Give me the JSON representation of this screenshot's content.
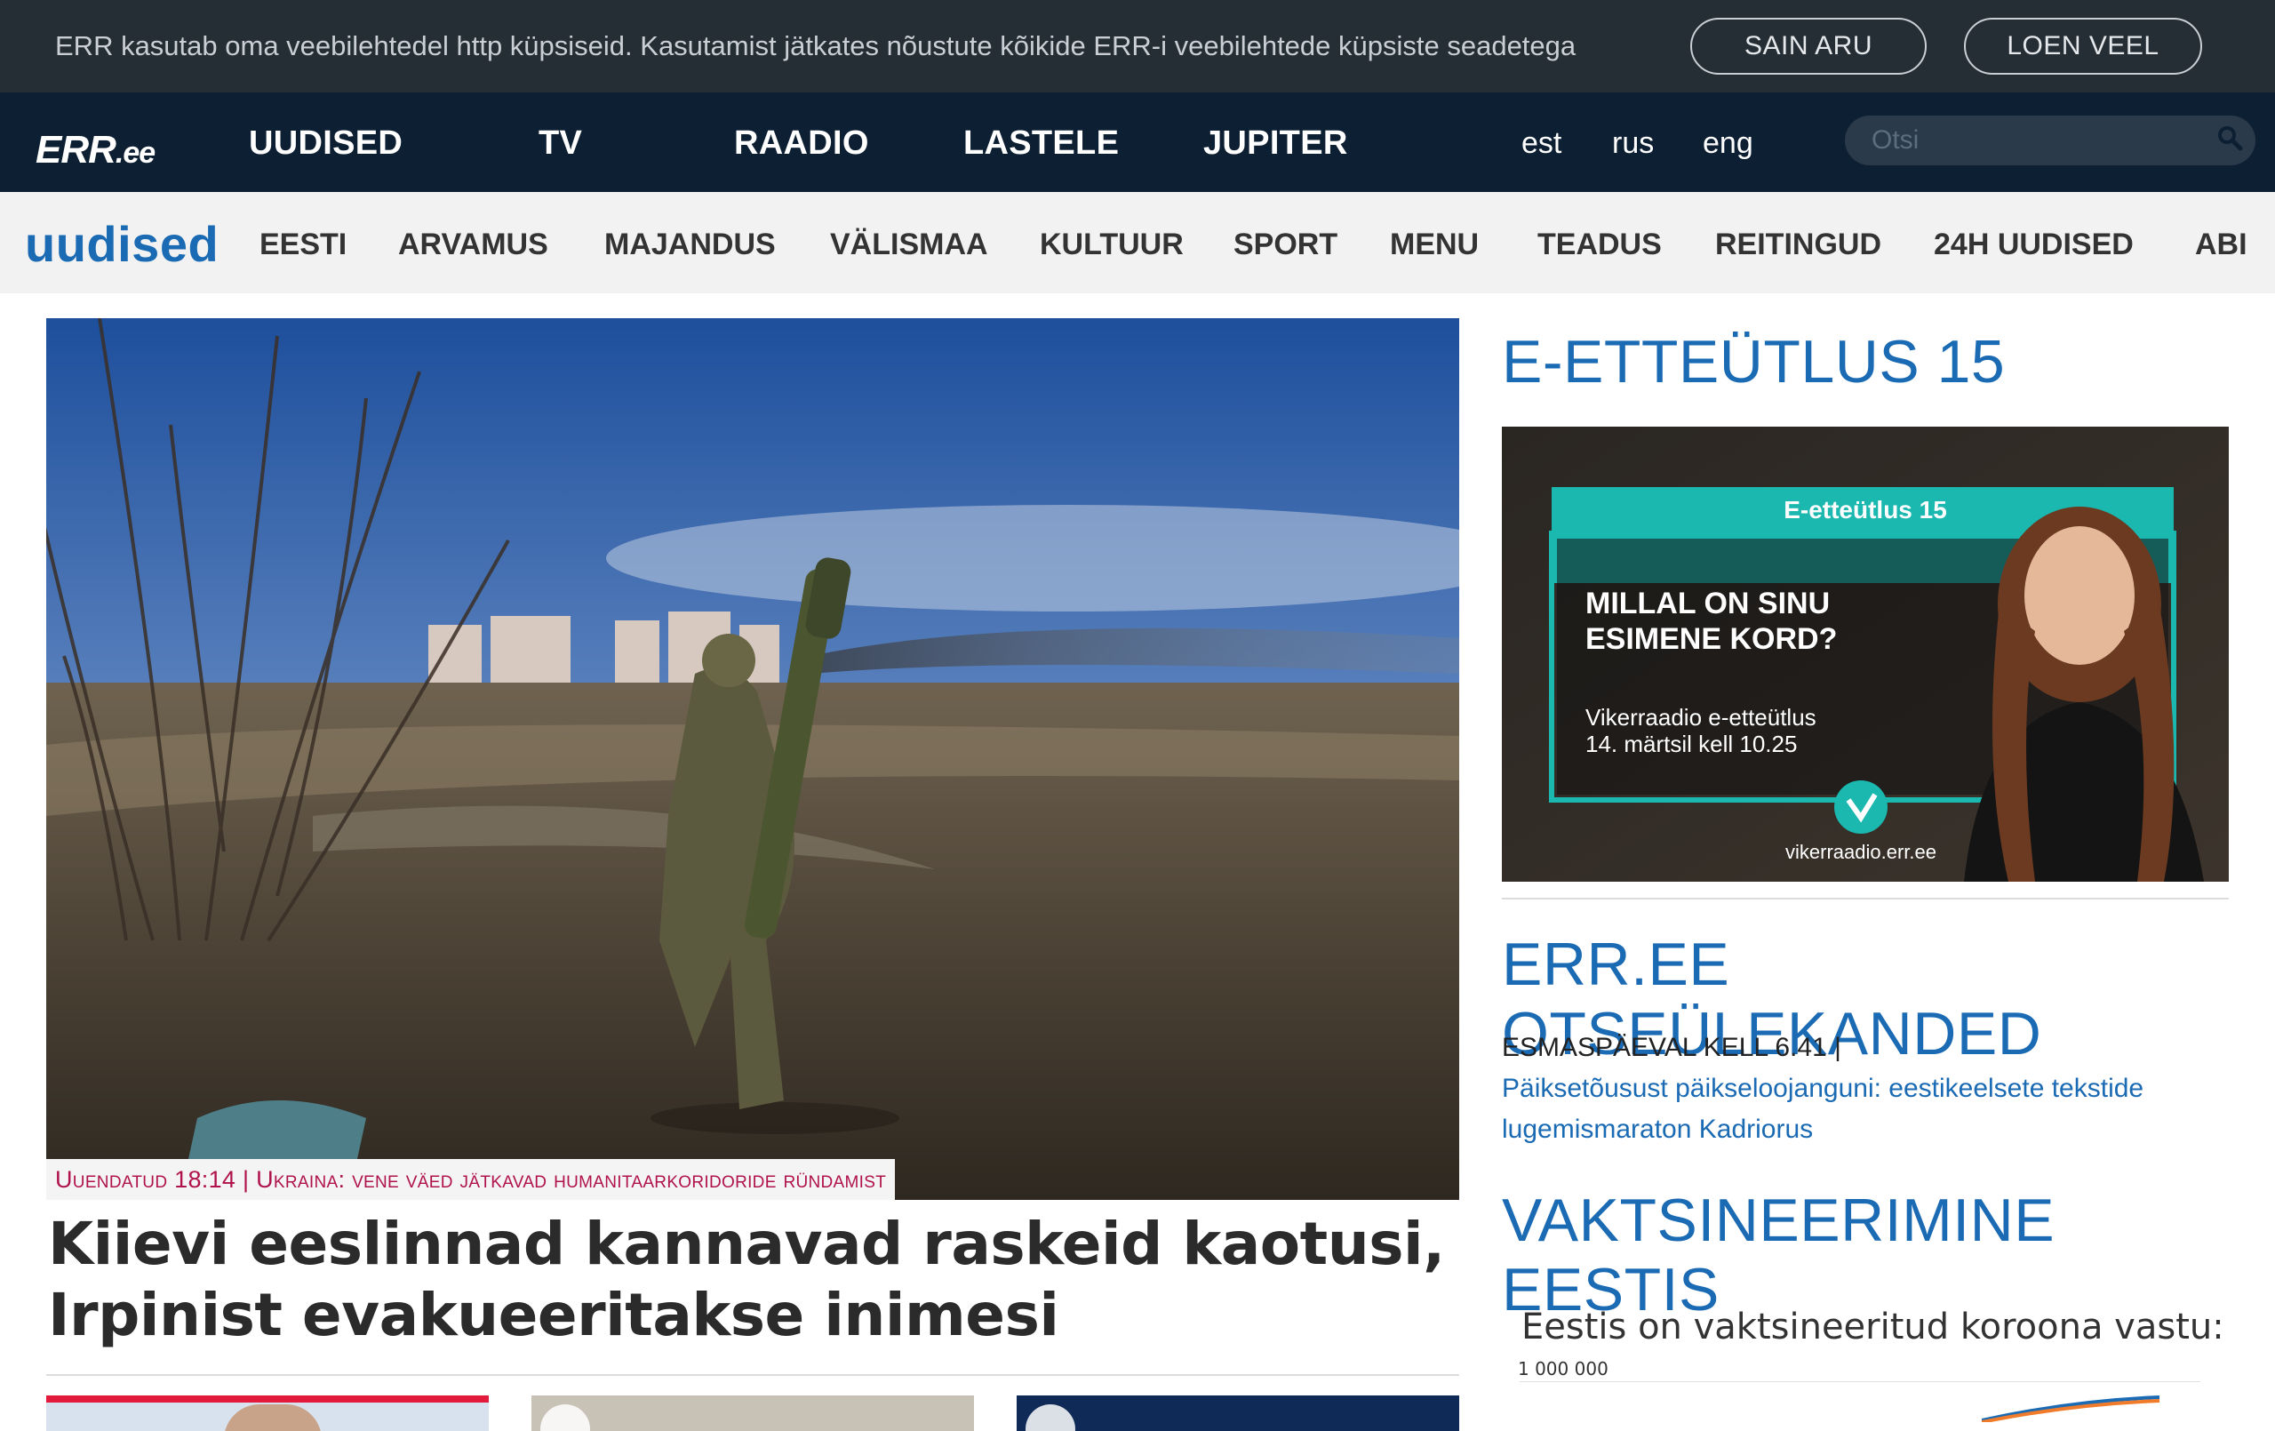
{
  "cookie": {
    "text": "ERR kasutab oma veebilehtedel http küpsiseid. Kasutamist jätkates nõustute kõikide ERR-i veebilehtede küpsiste seadetega",
    "accept_label": "SAIN ARU",
    "more_label": "LOEN VEEL"
  },
  "nav": {
    "logo": "ERR",
    "logo_suffix": ".ee",
    "items": [
      "UUDISED",
      "TV",
      "RAADIO",
      "LASTELE",
      "JUPITER"
    ],
    "languages": [
      "est",
      "rus",
      "eng"
    ],
    "search_placeholder": "Otsi"
  },
  "subnav": {
    "section_title": "uudised",
    "items": [
      "EESTI",
      "ARVAMUS",
      "MAJANDUS",
      "VÄLISMAA",
      "KULTUUR",
      "SPORT",
      "MENU",
      "TEADUS",
      "REITINGUD",
      "24H UUDISED",
      "ABI"
    ]
  },
  "hero": {
    "caption": "Uuendatud 18:14 | Ukraina: vene väed jätkavad humanitaarkoridoride ründamist",
    "headline": "Kiievi eeslinnad kannavad raskeid kaotusi, Irpinist evakueeritakse inimesi"
  },
  "sidebar": {
    "promo_heading": "E-ETTEÜTLUS 15",
    "promo": {
      "tag": "E-etteütlus 15",
      "line1": "MILLAL ON SINU",
      "line2": "ESIMENE KORD?",
      "sub1": "Vikerraadio e-etteütlus",
      "sub2": "14. märtsil kell 10.25",
      "url": "vikerraadio.err.ee"
    },
    "live_heading": "ERR.EE OTSEÜLEKANDED",
    "live_time": "ESMASPÄEVAL KELL 6.41 |",
    "live_link": "Päiksetõusust päikseloojanguni: eestikeelsete tekstide lugemismaraton Kadriorus",
    "vax_heading": "VAKTSINEERIMINE EESTIS",
    "vax_title": "Eestis on vaktsineeritud koroona vastu:",
    "vax_axis_label": "1 000 000"
  },
  "colors": {
    "accent": "#1a6ab4",
    "nav_bg": "#0d1f33",
    "cookie_bg": "#262e35",
    "caption": "#b0124b",
    "promo_teal": "#1bb8b0"
  }
}
